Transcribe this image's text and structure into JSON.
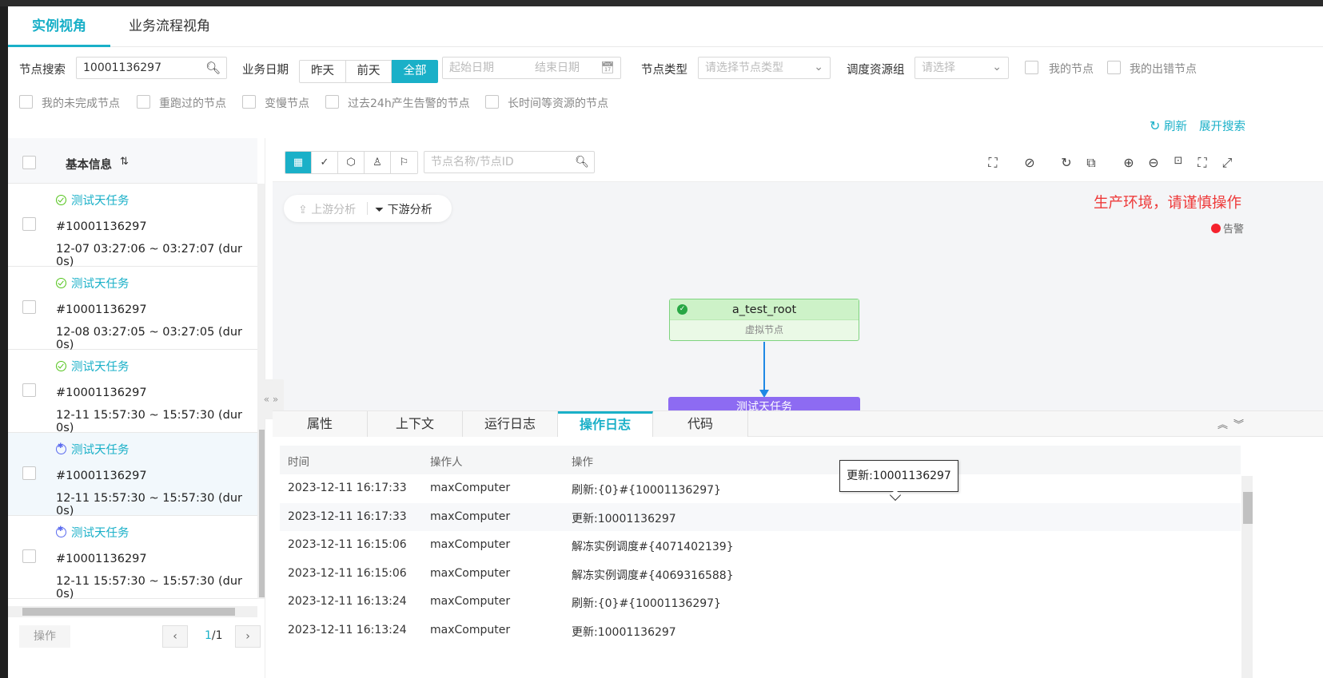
{
  "tabs": [
    "实例视角",
    "业务流程视角"
  ],
  "filters": {
    "search_label": "节点搜索",
    "search_value": "10001136297",
    "date_label": "业务日期",
    "date_options": [
      "昨天",
      "前天",
      "全部"
    ],
    "start_placeholder": "起始日期",
    "end_placeholder": "结束日期",
    "type_label": "节点类型",
    "type_placeholder": "请选择节点类型",
    "group_label": "调度资源组",
    "group_placeholder": "请选择",
    "checks": [
      "我的节点",
      "我的出错节点",
      "我的未完成节点",
      "重跑过的节点",
      "变慢节点",
      "过去24h产生告警的节点",
      "长时间等资源的节点"
    ],
    "refresh": "刷新",
    "expand": "展开搜索"
  },
  "left": {
    "header": "基本信息",
    "items": [
      {
        "name": "测试天任务",
        "id": "#10001136297",
        "time": "12-07 03:27:06 ~ 03:27:07 (dur 0s)",
        "status": "ok"
      },
      {
        "name": "测试天任务",
        "id": "#10001136297",
        "time": "12-08 03:27:05 ~ 03:27:05 (dur 0s)",
        "status": "ok"
      },
      {
        "name": "测试天任务",
        "id": "#10001136297",
        "time": "12-11 15:57:30 ~ 15:57:30 (dur 0s)",
        "status": "ok"
      },
      {
        "name": "测试天任务",
        "id": "#10001136297",
        "time": "12-11 15:57:30 ~ 15:57:30 (dur 0s)",
        "status": "run"
      },
      {
        "name": "测试天任务",
        "id": "#10001136297",
        "time": "12-11 15:57:30 ~ 15:57:30 (dur 0s)",
        "status": "run"
      }
    ],
    "footer_op": "操作",
    "page_current": "1",
    "page_total": "/1"
  },
  "graph": {
    "search_placeholder": "节点名称/节点ID",
    "upstream": "上游分析",
    "downstream": "下游分析",
    "env_warning": "生产环境，请谨慎操作",
    "alarm": "告警",
    "node_name": "a_test_root",
    "node_type": "虚拟节点",
    "node2_name": "测试天任务"
  },
  "bottom_tabs": [
    "属性",
    "上下文",
    "运行日志",
    "操作日志",
    "代码"
  ],
  "log": {
    "headers": [
      "时间",
      "操作人",
      "操作"
    ],
    "rows": [
      [
        "2023-12-11 16:17:33",
        "maxComputer",
        "刷新:{0}#{10001136297}"
      ],
      [
        "2023-12-11 16:17:33",
        "maxComputer",
        "更新:10001136297"
      ],
      [
        "2023-12-11 16:15:06",
        "maxComputer",
        "解冻实例调度#{4071402139}"
      ],
      [
        "2023-12-11 16:15:06",
        "maxComputer",
        "解冻实例调度#{4069316588}"
      ],
      [
        "2023-12-11 16:13:24",
        "maxComputer",
        "刷新:{0}#{10001136297}"
      ],
      [
        "2023-12-11 16:13:24",
        "maxComputer",
        "更新:10001136297"
      ]
    ],
    "tooltip": "更新:10001136297"
  }
}
